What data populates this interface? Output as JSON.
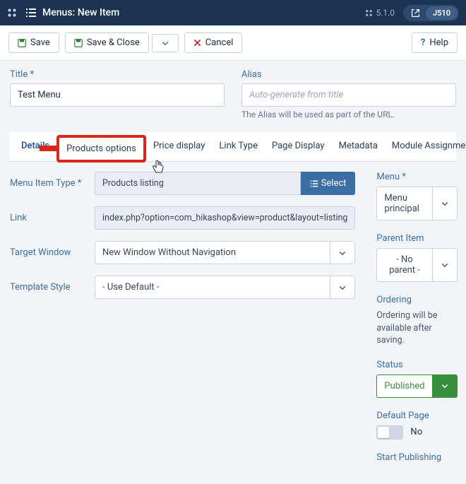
{
  "header": {
    "page_title": "Menus: New Item",
    "version": "5.1.0",
    "env_badge": "J510"
  },
  "toolbar": {
    "save": "Save",
    "save_close": "Save & Close",
    "cancel": "Cancel",
    "help": "Help"
  },
  "fields": {
    "title_label": "Title *",
    "title_value": "Test Menu",
    "alias_label": "Alias",
    "alias_placeholder": "Auto-generate from title",
    "alias_helper": "The Alias will be used as part of the URL."
  },
  "tabs": {
    "details": "Details",
    "products_options": "Products options",
    "price_display": "Price display",
    "link_type": "Link Type",
    "page_display": "Page Display",
    "metadata": "Metadata",
    "module_assignment": "Module Assignment"
  },
  "form": {
    "menu_item_type_label": "Menu Item Type *",
    "menu_item_type_value": "Products listing",
    "select_button": "Select",
    "link_label": "Link",
    "link_value": "index.php?option=com_hikashop&view=product&layout=listing",
    "target_label": "Target Window",
    "target_value": "New Window Without Navigation",
    "template_label": "Template Style",
    "template_value": "- Use Default -"
  },
  "sidebar": {
    "menu_label": "Menu *",
    "menu_value": "Menu principal",
    "parent_label": "Parent Item",
    "parent_value": "- No parent -",
    "ordering_label": "Ordering",
    "ordering_note": "Ordering will be available after saving.",
    "status_label": "Status",
    "status_value": "Published",
    "default_page_label": "Default Page",
    "default_page_value": "No",
    "start_publishing_label": "Start Publishing"
  }
}
